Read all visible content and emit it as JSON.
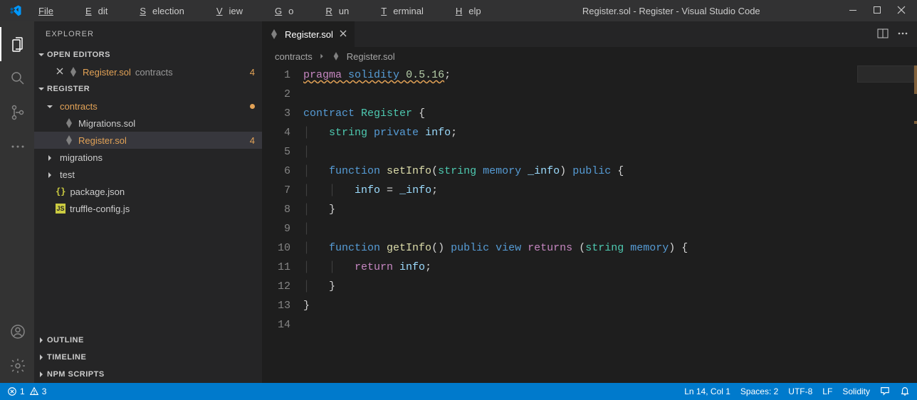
{
  "titlebar": {
    "title": "Register.sol - Register - Visual Studio Code",
    "menu": {
      "file": "File",
      "edit": "Edit",
      "selection": "Selection",
      "view": "View",
      "go": "Go",
      "run": "Run",
      "terminal": "Terminal",
      "help": "Help"
    }
  },
  "explorer": {
    "title": "EXPLORER",
    "open_editors": "OPEN EDITORS",
    "open_file": {
      "name": "Register.sol",
      "dir": "contracts",
      "badge": "4"
    },
    "project": "REGISTER",
    "tree": {
      "contracts": "contracts",
      "migrations_file": "Migrations.sol",
      "register_file": "Register.sol",
      "register_badge": "4",
      "migrations_folder": "migrations",
      "test_folder": "test",
      "package_json": "package.json",
      "truffle_config": "truffle-config.js"
    },
    "outline": "OUTLINE",
    "timeline": "TIMELINE",
    "npm": "NPM SCRIPTS"
  },
  "editor": {
    "tab": {
      "name": "Register.sol"
    },
    "breadcrumbs": {
      "folder": "contracts",
      "file": "Register.sol"
    },
    "lines": {
      "l1_a": "pragma",
      "l1_b": "solidity",
      "l1_c": "0.5.16",
      "l3_a": "contract",
      "l3_b": "Register",
      "l4_a": "string",
      "l4_b": "private",
      "l4_c": "info",
      "l6_a": "function",
      "l6_b": "setInfo",
      "l6_c": "string",
      "l6_d": "memory",
      "l6_e": "_info",
      "l6_f": "public",
      "l7_a": "info",
      "l7_b": "_info",
      "l10_a": "function",
      "l10_b": "getInfo",
      "l10_c": "public",
      "l10_d": "view",
      "l10_e": "returns",
      "l10_f": "string",
      "l10_g": "memory",
      "l11_a": "return",
      "l11_b": "info"
    }
  },
  "statusbar": {
    "errors": "1",
    "warnings": "3",
    "ln_col": "Ln 14, Col 1",
    "spaces": "Spaces: 2",
    "encoding": "UTF-8",
    "eol": "LF",
    "language": "Solidity"
  }
}
